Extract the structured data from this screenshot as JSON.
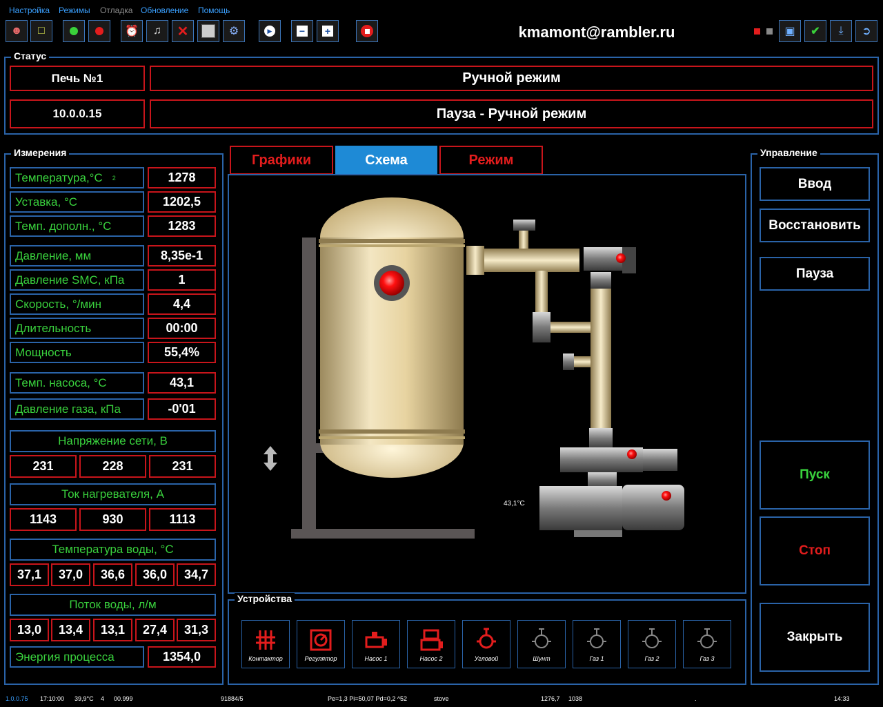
{
  "menu": [
    "Настройка",
    "Режимы",
    "Отладка",
    "Обновление",
    "Помощь"
  ],
  "toolbar": {
    "email": "kmamont@rambler.ru",
    "icons": [
      "user-icon",
      "folder-open-icon",
      "green-light-icon",
      "red-light-icon",
      "alarm-clock-icon",
      "music-note-icon",
      "close-icon",
      "save-icon",
      "settings-icon",
      "play-icon",
      "zoom-out-icon",
      "zoom-in-icon",
      "stop-icon",
      "monitor-icon",
      "check-icon",
      "download-icon",
      "exit-icon"
    ]
  },
  "status": {
    "title": "Статус",
    "furnace": "Печь №1",
    "mode": "Ручной режим",
    "ip": "10.0.0.15",
    "state": "Пауза - Ручной режим"
  },
  "measurements": {
    "title": "Измерения",
    "rows": [
      {
        "label": "Температура,°С",
        "sub": "2",
        "value": "1278"
      },
      {
        "label": "Уставка, °С",
        "value": "1202,5"
      },
      {
        "label": "Темп. дополн., °С",
        "value": "1283"
      },
      {
        "label": "Давление, мм",
        "value": "8,35e-1"
      },
      {
        "label": "Давление SMC, кПа",
        "value": "1"
      },
      {
        "label": "Скорость, °/мин",
        "value": "4,4"
      },
      {
        "label": "Длительность",
        "value": "00:00"
      },
      {
        "label": "Мощность",
        "value": "55,4%"
      },
      {
        "label": "Темп. насоса, °С",
        "value": "43,1"
      },
      {
        "label": "Давление газа, кПа",
        "value": "-0'01"
      }
    ],
    "voltage": {
      "label": "Напряжение сети, В",
      "values": [
        "231",
        "228",
        "231"
      ]
    },
    "current": {
      "label": "Ток нагревателя, А",
      "values": [
        "1143",
        "930",
        "1113"
      ]
    },
    "water_temp": {
      "label": "Температура воды, °С",
      "values": [
        "37,1",
        "37,0",
        "36,6",
        "36,0",
        "34,7"
      ]
    },
    "water_flow": {
      "label": "Поток воды, л/м",
      "values": [
        "13,0",
        "13,4",
        "13,1",
        "27,4",
        "31,3"
      ]
    },
    "energy": {
      "label": "Энергия процесса",
      "value": "1354,0"
    }
  },
  "tabs": [
    "Графики",
    "Схема",
    "Режим"
  ],
  "scheme": {
    "pump_temp": "43,1°C"
  },
  "devices": {
    "title": "Устройства",
    "items": [
      {
        "label": "Контактор",
        "active": true
      },
      {
        "label": "Регулятор",
        "active": true
      },
      {
        "label": "Насос 1",
        "active": true
      },
      {
        "label": "Насос 2",
        "active": true
      },
      {
        "label": "Угловой",
        "active": true
      },
      {
        "label": "Шунт",
        "active": false
      },
      {
        "label": "Газ 1",
        "active": false
      },
      {
        "label": "Газ 2",
        "active": false
      },
      {
        "label": "Газ 3",
        "active": false
      }
    ]
  },
  "control": {
    "title": "Управление",
    "enter": "Ввод",
    "restore": "Восстановить",
    "pause": "Пауза",
    "start": "Пуск",
    "stop": "Стоп",
    "close": "Закрыть"
  },
  "statusbar": [
    "1.0.0.75",
    "17:10:00",
    "39,9°C",
    "4",
    "00.999",
    "91884/5",
    "Pe=1,3 Pi=50,07 Pd=0,2 ^52",
    "stove",
    "1276,7",
    "1038",
    ".",
    "14:33"
  ],
  "colors": {
    "accent_red": "#c8151b",
    "frame_blue": "#2a63a8",
    "label_green": "#39d13d",
    "tab_active": "#1e8ad6"
  }
}
